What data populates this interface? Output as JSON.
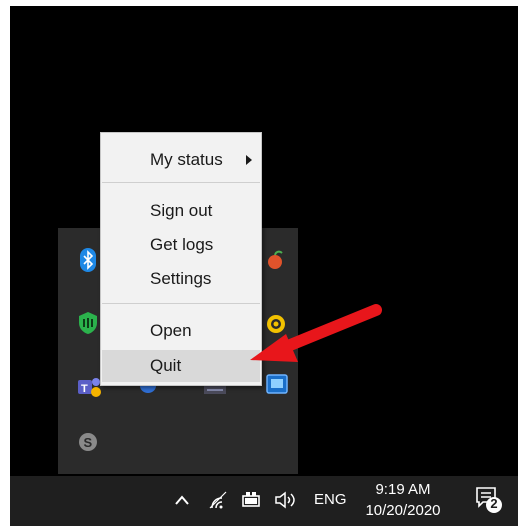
{
  "menu": {
    "items": [
      {
        "label": "My status",
        "has_submenu": true
      },
      {
        "label": "Sign out"
      },
      {
        "label": "Get logs"
      },
      {
        "label": "Settings"
      },
      {
        "label": "Open"
      },
      {
        "label": "Quit",
        "highlighted": true
      }
    ]
  },
  "taskbar": {
    "language": "ENG",
    "time": "9:19 AM",
    "date": "10/20/2020",
    "notification_count": "2"
  },
  "tray_icons": [
    "bluetooth-icon",
    "fruit-app-icon",
    "green-shield-icon",
    "yellow-circle-icon",
    "teams-icon",
    "blue-app-icon",
    "grey-app-icon",
    "display-icon",
    "skype-icon"
  ],
  "colors": {
    "annotation_arrow": "#e8161b",
    "menu_background": "#f2f2f2",
    "menu_highlight": "#d9d9d9",
    "taskbar": "#1f1f1f"
  }
}
